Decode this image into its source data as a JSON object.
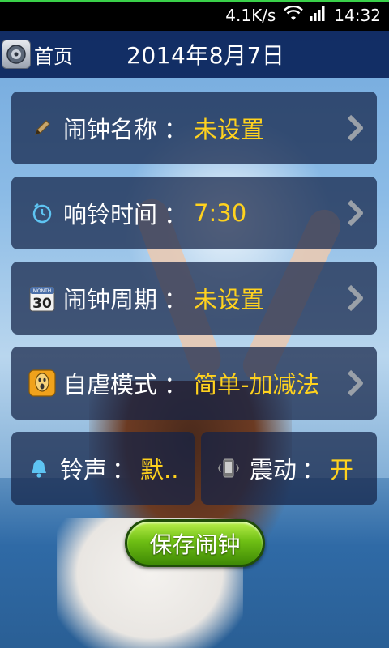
{
  "status_bar": {
    "net_speed": "4.1K/s",
    "time": "14:32",
    "wifi_icon": "wifi-icon",
    "signal_icon": "signal-icon"
  },
  "header": {
    "home_label": "首页",
    "home_icon": "home-icon",
    "date": "2014年8月7日"
  },
  "rows": {
    "name": {
      "label": "闹钟名称",
      "sep": "：",
      "value": "未设置",
      "icon": "pencil-icon"
    },
    "time": {
      "label": "响铃时间",
      "sep": "：",
      "value": "7:30",
      "icon": "stopwatch-icon"
    },
    "period": {
      "label": "闹钟周期",
      "sep": "：",
      "value": "未设置",
      "icon": "calendar-icon",
      "calendar_day": "30",
      "calendar_month": "MONTH"
    },
    "mode": {
      "label": "自虐模式",
      "sep": "：",
      "value": "简单-加减法",
      "icon": "scream-icon"
    }
  },
  "ringtone": {
    "label": "铃声",
    "sep": "：",
    "value": "默..",
    "icon": "bell-icon"
  },
  "vibrate": {
    "label": "震动",
    "sep": "：",
    "value": "开",
    "icon": "vibrate-phone-icon"
  },
  "save_button": {
    "label": "保存闹钟"
  },
  "colors": {
    "value_text": "#ffd21e",
    "row_bg": "rgba(20,35,70,0.72)",
    "header_bg": "#0a235a",
    "button_green": "#6fbf14",
    "status_progress": "#3ad14a"
  }
}
